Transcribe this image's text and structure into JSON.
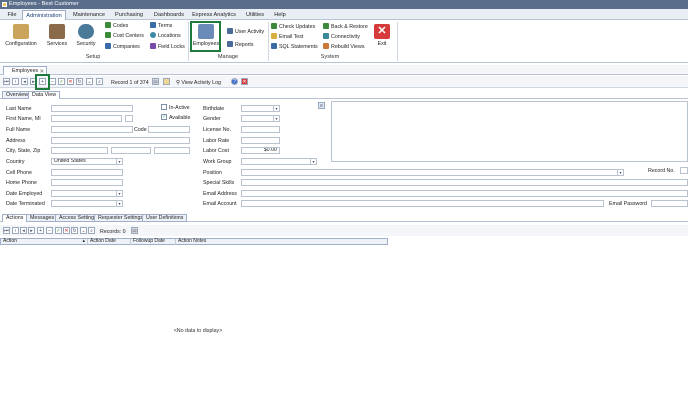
{
  "window": {
    "title": "Employees - Best Customer"
  },
  "menu": {
    "tabs": [
      "File",
      "Administration",
      "Maintenance",
      "Purchasing",
      "Dashboards",
      "Express Analytics",
      "Utilities",
      "Help"
    ],
    "active": "Administration"
  },
  "ribbon": {
    "setup": {
      "configuration": "Configuration",
      "services": "Services",
      "security": "Security",
      "codes": "Codes",
      "cost_centers": "Cost Centers",
      "companies": "Companies",
      "terms": "Terms",
      "locations": "Locations",
      "field_locks": "Field Locks",
      "group": "Setup"
    },
    "manage": {
      "employees": "Employees",
      "user_activity": "User Activity",
      "reports": "Reports",
      "group": "Manage"
    },
    "system": {
      "check_updates": "Check Updates",
      "email_test": "Email Test",
      "sql_statements": "SQL Statements",
      "back_restore": "Back & Restore",
      "connectivity": "Connectivity",
      "rebuild_views": "Rebuild Views",
      "exit": "Exit",
      "group": "System"
    }
  },
  "doc_tab": {
    "label": "Employees"
  },
  "toolbar": {
    "record": "Record 1 of 374",
    "view_activity": "View Activity Log"
  },
  "view_tabs": [
    "Overview",
    "Data View"
  ],
  "form": {
    "last_name": "Last Name",
    "first_name": "First Name, MI",
    "full_name": "Full Name",
    "code": "Code",
    "address": "Address",
    "city_state_zip": "City, State, Zip",
    "country": "Country",
    "country_value": "United States",
    "cell_phone": "Cell Phone",
    "home_phone": "Home Phone",
    "date_employed": "Date Employed",
    "date_terminated": "Date Terminated",
    "inactive": "In-Active",
    "available": "Available",
    "birthdate": "Birthdate",
    "gender": "Gender",
    "license_no": "License No.",
    "labor_rate": "Labor Rate",
    "labor_cost": "Labor Cost",
    "labor_cost_value": "$0.00",
    "work_group": "Work Group",
    "position": "Position",
    "special_skills": "Special Skills",
    "email_address": "Email Address",
    "email_account": "Email Account",
    "record_no": "Record No.",
    "email_password": "Email Password"
  },
  "bottom_tabs": [
    "Actions",
    "Messages",
    "Access Settings",
    "Requester Settings",
    "User Definitions"
  ],
  "grid": {
    "records": "Records: 0",
    "columns": [
      "Action",
      "Action Date",
      "Followup Date",
      "Action Notes"
    ],
    "empty": "<No data to display>"
  },
  "colors": {
    "highlight": "#1f7a3e",
    "exit_red": "#d63a3a"
  }
}
